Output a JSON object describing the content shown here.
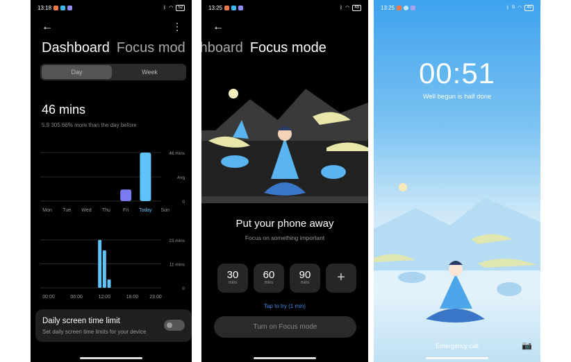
{
  "screen1": {
    "status": {
      "time": "13:18",
      "battery": "52"
    },
    "tabs": [
      "Dashboard",
      "Focus mod"
    ],
    "segment": {
      "options": [
        "Day",
        "Week"
      ],
      "selected": "Day"
    },
    "total": "46 mins",
    "comparison": "5.9 305.66% more than the day before",
    "limit_card": {
      "title": "Daily screen time limit",
      "subtitle": "Set daily screen time limits for your device",
      "enabled": false
    }
  },
  "chart_data": [
    {
      "type": "bar",
      "categories": [
        "Mon",
        "Tue",
        "Wed",
        "Thu",
        "Fri",
        "Today",
        "Sun"
      ],
      "values": [
        0,
        0,
        0,
        0,
        11,
        46,
        0
      ],
      "y_labels": [
        "46 mins",
        "Avg",
        "0"
      ],
      "ylim": [
        0,
        46
      ],
      "colors": {
        "Fri": "#7b7cf2",
        "Today": "#5ec2fb"
      },
      "highlight": "Today"
    },
    {
      "type": "bar",
      "x_labels": [
        "00:00",
        "06:00",
        "12:00",
        "18:00",
        "23:00"
      ],
      "hours": [
        11,
        12,
        13
      ],
      "values": [
        23,
        18,
        4
      ],
      "y_labels": [
        "23 mins",
        "11 mins",
        "0"
      ],
      "ylim": [
        0,
        23
      ],
      "color": "#5ec2fb"
    }
  ],
  "screen2": {
    "status": {
      "time": "13:25",
      "battery": "49"
    },
    "tabs": [
      "Dashboard",
      "Focus mode"
    ],
    "heading": "Put your phone away",
    "subheading": "Focus on something important",
    "durations": [
      {
        "value": "30",
        "unit": "mins"
      },
      {
        "value": "60",
        "unit": "mins"
      },
      {
        "value": "90",
        "unit": "mins"
      }
    ],
    "add_label": "+",
    "try_link": "Tap to try (1 min)",
    "start_button": "Turn on Focus mode"
  },
  "screen3": {
    "status": {
      "time": "13:25",
      "battery": "49"
    },
    "timer": "00:51",
    "motto": "Well begun is half done",
    "emergency": "Emergency call"
  }
}
